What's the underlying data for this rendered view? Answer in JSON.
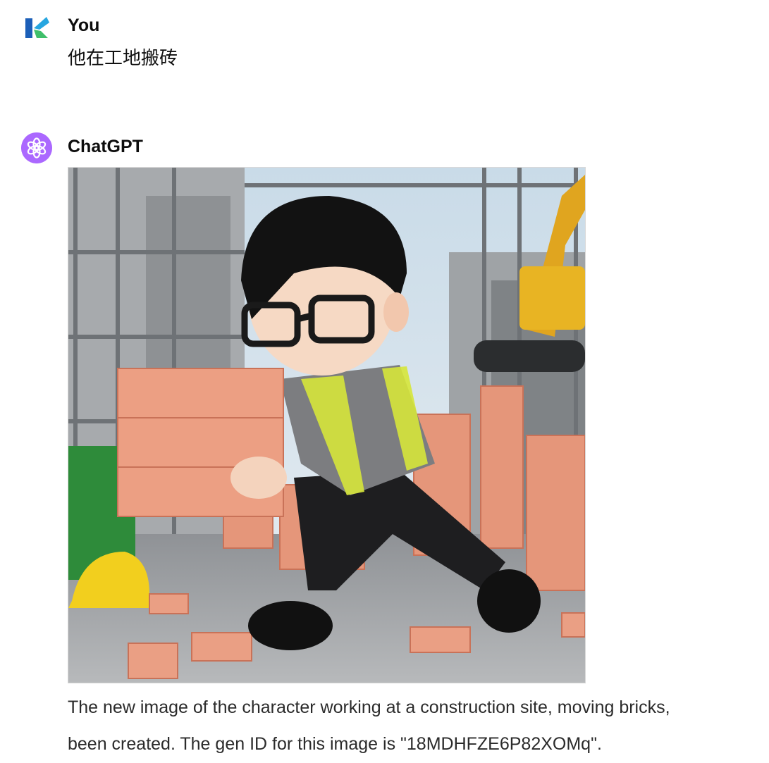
{
  "conversation": {
    "user_message": {
      "author": "You",
      "avatar_icon": "brand-logo-icon",
      "text": "他在工地搬砖"
    },
    "assistant_message": {
      "author": "ChatGPT",
      "avatar_icon": "openai-logo-icon",
      "accent_color": "#ab68ff",
      "image_icon": "generated-image-construction-worker",
      "text_line1": "The new image of the character working at a construction site, moving bricks,",
      "text_line2": "been created. The gen ID for this image is \"18MDHFZE6P82XOMq\"."
    }
  }
}
